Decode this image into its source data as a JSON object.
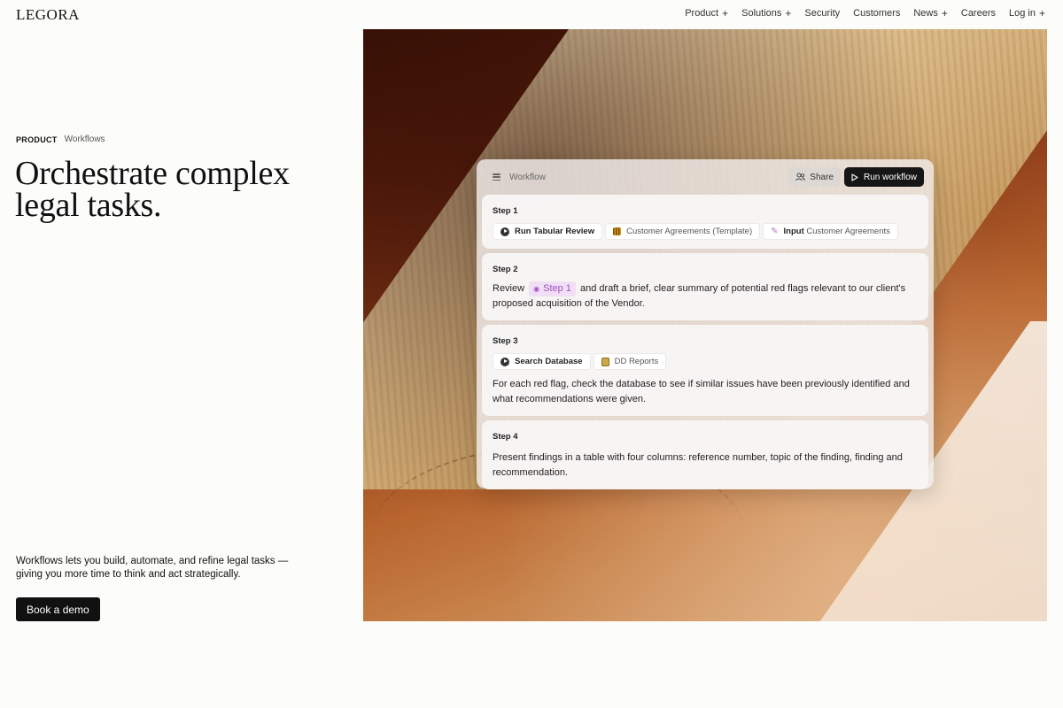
{
  "brand": {
    "logo": "LEGORA"
  },
  "nav": {
    "items": [
      {
        "label": "Product",
        "plus": "+"
      },
      {
        "label": "Solutions",
        "plus": "+"
      },
      {
        "label": "Security",
        "plus": ""
      },
      {
        "label": "Customers",
        "plus": ""
      },
      {
        "label": "News",
        "plus": "+"
      },
      {
        "label": "Careers",
        "plus": ""
      },
      {
        "label": "Log in",
        "plus": "+"
      }
    ]
  },
  "breadcrumb": {
    "section": "PRODUCT",
    "page": "Workflows"
  },
  "hero": {
    "headline": "Orchestrate complex legal tasks.",
    "description": "Workflows lets you build, automate, and refine legal tasks —giving you more time to think and act strategically.",
    "cta": "Book a demo"
  },
  "workflow": {
    "title": "Workflow",
    "share_label": "Share",
    "run_label": "Run workflow",
    "steps": [
      {
        "label": "Step 1",
        "chips": [
          {
            "icon": "play-icon",
            "strong": "Run Tabular Review",
            "text": ""
          },
          {
            "icon": "table-icon",
            "strong": "",
            "text": "Customer Agreements (Template)"
          },
          {
            "icon": "paperclip-icon",
            "strong": "Input",
            "text": "Customer Agreements"
          }
        ]
      },
      {
        "label": "Step 2",
        "text_before": "Review",
        "tag": "Step 1",
        "text_after": "and draft a brief, clear summary of potential red flags relevant to our client's proposed acquisition of the Vendor."
      },
      {
        "label": "Step 3",
        "chips": [
          {
            "icon": "play-icon",
            "strong": "Search Database",
            "text": ""
          },
          {
            "icon": "database-icon",
            "strong": "",
            "text": "DD Reports"
          }
        ],
        "text": "For each red flag, check the database to see if similar issues have been previously identified and what recommendations were given."
      },
      {
        "label": "Step 4",
        "text": "Present findings in a table with four columns: reference number, topic of the finding, finding and recommendation."
      }
    ]
  },
  "colors": {
    "background": "#fcfcfa",
    "button_dark": "#111111",
    "tag_purple": "#a14fc2"
  }
}
